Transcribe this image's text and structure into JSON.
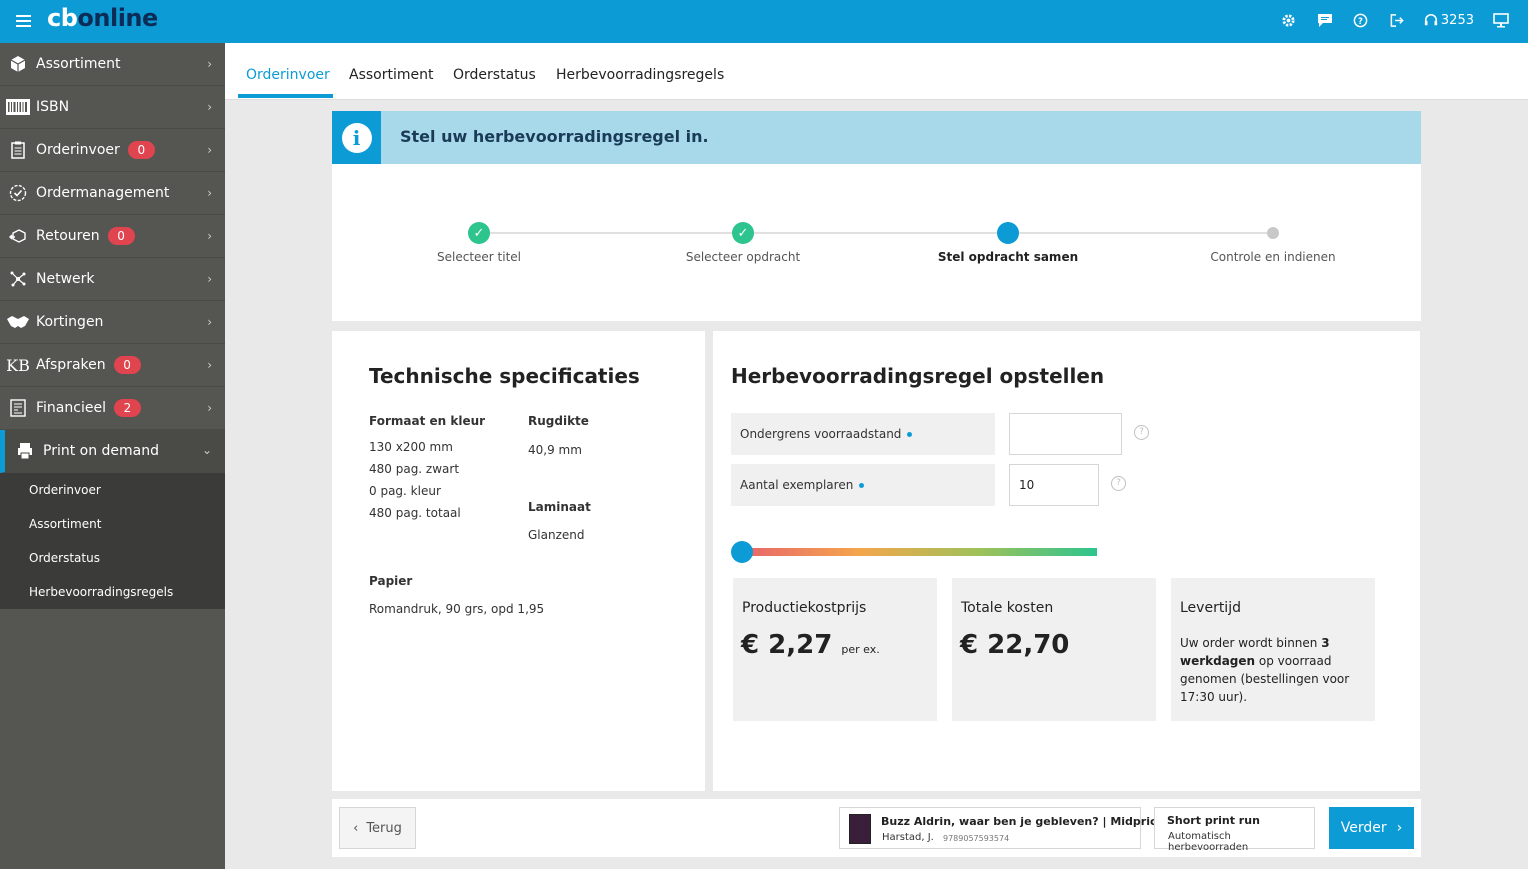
{
  "app": {
    "logo_prefix": "cb",
    "logo_suffix": "online"
  },
  "topbar": {
    "notification_count": "3253"
  },
  "sidebar": {
    "items": [
      {
        "label": "Assortiment",
        "badge": ""
      },
      {
        "label": "ISBN",
        "badge": ""
      },
      {
        "label": "Orderinvoer",
        "badge": "0"
      },
      {
        "label": "Ordermanagement",
        "badge": ""
      },
      {
        "label": "Retouren",
        "badge": "0"
      },
      {
        "label": "Netwerk",
        "badge": ""
      },
      {
        "label": "Kortingen",
        "badge": ""
      },
      {
        "label": "Afspraken",
        "badge": "0"
      },
      {
        "label": "Financieel",
        "badge": "2"
      },
      {
        "label": "Print on demand",
        "badge": ""
      }
    ],
    "sub_items": [
      "Orderinvoer",
      "Assortiment",
      "Orderstatus",
      "Herbevoorradingsregels"
    ]
  },
  "tabs": [
    "Orderinvoer",
    "Assortiment",
    "Orderstatus",
    "Herbevoorradingsregels"
  ],
  "banner": {
    "text": "Stel uw herbevoorradingsregel in."
  },
  "stepper": {
    "steps": [
      "Selecteer titel",
      "Selecteer opdracht",
      "Stel opdracht samen",
      "Controle en indienen"
    ]
  },
  "specs": {
    "title": "Technische specificaties",
    "format_heading": "Formaat en kleur",
    "format_lines": [
      "130 x200 mm",
      "480 pag. zwart",
      "0 pag. kleur",
      "480 pag. totaal"
    ],
    "spine_heading": "Rugdikte",
    "spine_value": "40,9 mm",
    "laminate_heading": "Laminaat",
    "laminate_value": "Glanzend",
    "paper_heading": "Papier",
    "paper_value": "Romandruk, 90 grs, opd 1,95"
  },
  "rule": {
    "title": "Herbevoorradingsregel opstellen",
    "lower_limit_label": "Ondergrens voorraadstand",
    "lower_limit_value": "",
    "copies_label": "Aantal exemplaren",
    "copies_value": "10",
    "slider_fraction": 0.0
  },
  "cards": {
    "unit_cost_title": "Productiekostprijs",
    "unit_cost_value": "€ 2,27",
    "unit_cost_suffix": "per ex.",
    "total_title": "Totale kosten",
    "total_value": "€ 22,70",
    "delivery_title": "Levertijd",
    "delivery_pre": "Uw order wordt binnen ",
    "delivery_bold": "3 werkdagen",
    "delivery_post": " op voorraad genomen (bestellingen voor 17:30 uur)."
  },
  "footer": {
    "back_label": "Terug",
    "book_title": "Buzz Aldrin, waar ben je gebleven? | Midprice",
    "book_author": "Harstad, J.",
    "book_isbn": "9789057593574",
    "run_title": "Short print run",
    "run_subtitle": "Automatisch herbevoorraden",
    "next_label": "Verder"
  },
  "colors": {
    "accent": "#0d9bd6",
    "success": "#2dc48d",
    "badge": "#e0444f",
    "sidebar": "#555552"
  }
}
